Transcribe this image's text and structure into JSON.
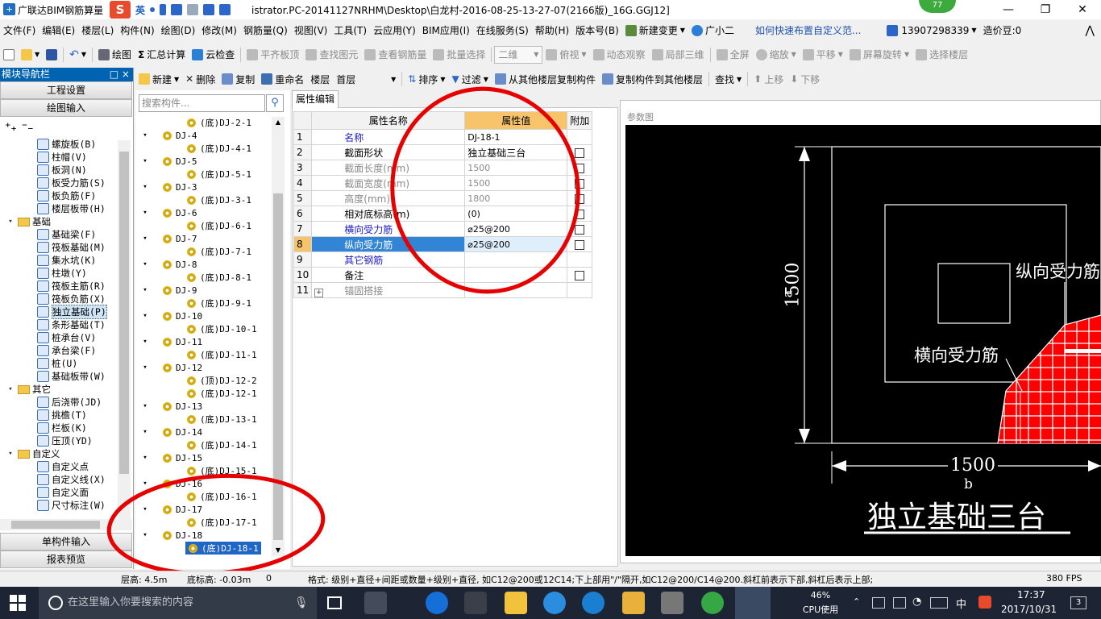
{
  "window": {
    "title": "广联达BIM钢筋算量",
    "title_path": "istrator.PC-20141127NRHM\\Desktop\\白龙村-2016-08-25-13-27-07(2166版)_16G.GGJ12]",
    "badge": "77",
    "ime": {
      "logo": "S",
      "lang": "英"
    }
  },
  "menu": [
    "文件(F)",
    "编辑(E)",
    "楼层(L)",
    "构件(N)",
    "绘图(D)",
    "修改(M)",
    "钢筋量(Q)",
    "视图(V)",
    "工具(T)",
    "云应用(Y)",
    "BIM应用(I)",
    "在线服务(S)",
    "帮助(H)",
    "版本号(B)",
    "新建变更",
    "广小二"
  ],
  "menu_extra": {
    "link": "如何快速布置自定义范...",
    "phone": "13907298339",
    "coins": "造价豆:0"
  },
  "toolbar": {
    "draw": "绘图",
    "sum": "汇总计算",
    "cloud_check": "云检查",
    "flat": "平齐板顶",
    "find_elem": "查找图元",
    "view_rebar": "查看钢筋量",
    "batch_select": "批量选择",
    "view_mode": "二维",
    "bird_view": "俯视",
    "dyn_view": "动态观察",
    "local_3d": "局部三维",
    "full_screen": "全屏",
    "zoom": "缩放",
    "pan": "平移",
    "rotate": "屏幕旋转",
    "select_layer": "选择楼层"
  },
  "subtoolbar": {
    "new": "新建",
    "delete": "删除",
    "copy": "复制",
    "rename": "重命名",
    "floor_label": "楼层",
    "floor_value": "首层",
    "sort": "排序",
    "filter": "过滤",
    "copy_from": "从其他楼层复制构件",
    "copy_to": "复制构件到其他楼层",
    "find": "查找",
    "up": "上移",
    "down": "下移"
  },
  "leftnav": {
    "header": "模块导航栏",
    "pin": "□ ×",
    "project_settings": "工程设置",
    "drawing_input": "绘图输入",
    "items": [
      {
        "label": "螺旋板(B)",
        "type": "item"
      },
      {
        "label": "柱帽(V)",
        "type": "item"
      },
      {
        "label": "板洞(N)",
        "type": "item"
      },
      {
        "label": "板受力筋(S)",
        "type": "item"
      },
      {
        "label": "板负筋(F)",
        "type": "item"
      },
      {
        "label": "楼层板带(H)",
        "type": "item"
      },
      {
        "label": "基础",
        "type": "folder"
      },
      {
        "label": "基础梁(F)",
        "type": "item"
      },
      {
        "label": "筏板基础(M)",
        "type": "item"
      },
      {
        "label": "集水坑(K)",
        "type": "item"
      },
      {
        "label": "柱墩(Y)",
        "type": "item"
      },
      {
        "label": "筏板主筋(R)",
        "type": "item"
      },
      {
        "label": "筏板负筋(X)",
        "type": "item"
      },
      {
        "label": "独立基础(P)",
        "type": "item",
        "selected": true
      },
      {
        "label": "条形基础(T)",
        "type": "item"
      },
      {
        "label": "桩承台(V)",
        "type": "item"
      },
      {
        "label": "承台梁(F)",
        "type": "item"
      },
      {
        "label": "桩(U)",
        "type": "item"
      },
      {
        "label": "基础板带(W)",
        "type": "item"
      },
      {
        "label": "其它",
        "type": "folder"
      },
      {
        "label": "后浇带(JD)",
        "type": "item"
      },
      {
        "label": "挑檐(T)",
        "type": "item"
      },
      {
        "label": "栏板(K)",
        "type": "item"
      },
      {
        "label": "压顶(YD)",
        "type": "item"
      },
      {
        "label": "自定义",
        "type": "folder"
      },
      {
        "label": "自定义点",
        "type": "item"
      },
      {
        "label": "自定义线(X)",
        "type": "item"
      },
      {
        "label": "自定义面",
        "type": "item"
      },
      {
        "label": "尺寸标注(W)",
        "type": "item"
      }
    ],
    "single_input": "单构件输入",
    "report": "报表预览"
  },
  "search": {
    "placeholder": "搜索构件..."
  },
  "components": [
    {
      "label": "(底)DJ-2-1",
      "level": 2
    },
    {
      "label": "DJ-4",
      "level": 1
    },
    {
      "label": "(底)DJ-4-1",
      "level": 2
    },
    {
      "label": "DJ-5",
      "level": 1
    },
    {
      "label": "(底)DJ-5-1",
      "level": 2
    },
    {
      "label": "DJ-3",
      "level": 1
    },
    {
      "label": "(底)DJ-3-1",
      "level": 2
    },
    {
      "label": "DJ-6",
      "level": 1
    },
    {
      "label": "(底)DJ-6-1",
      "level": 2
    },
    {
      "label": "DJ-7",
      "level": 1
    },
    {
      "label": "(底)DJ-7-1",
      "level": 2
    },
    {
      "label": "DJ-8",
      "level": 1
    },
    {
      "label": "(底)DJ-8-1",
      "level": 2
    },
    {
      "label": "DJ-9",
      "level": 1
    },
    {
      "label": "(底)DJ-9-1",
      "level": 2
    },
    {
      "label": "DJ-10",
      "level": 1
    },
    {
      "label": "(底)DJ-10-1",
      "level": 2
    },
    {
      "label": "DJ-11",
      "level": 1
    },
    {
      "label": "(底)DJ-11-1",
      "level": 2
    },
    {
      "label": "DJ-12",
      "level": 1
    },
    {
      "label": "(顶)DJ-12-2",
      "level": 2
    },
    {
      "label": "(底)DJ-12-1",
      "level": 2
    },
    {
      "label": "DJ-13",
      "level": 1
    },
    {
      "label": "(底)DJ-13-1",
      "level": 2
    },
    {
      "label": "DJ-14",
      "level": 1
    },
    {
      "label": "(底)DJ-14-1",
      "level": 2
    },
    {
      "label": "DJ-15",
      "level": 1
    },
    {
      "label": "(底)DJ-15-1",
      "level": 2
    },
    {
      "label": "DJ-16",
      "level": 1
    },
    {
      "label": "(底)DJ-16-1",
      "level": 2
    },
    {
      "label": "DJ-17",
      "level": 1
    },
    {
      "label": "(底)DJ-17-1",
      "level": 2
    },
    {
      "label": "DJ-18",
      "level": 1
    },
    {
      "label": "(底)DJ-18-1",
      "level": 2,
      "selected": true
    }
  ],
  "properties": {
    "tab": "属性编辑",
    "headers": {
      "name": "属性名称",
      "value": "属性值",
      "extra": "附加"
    },
    "rows": [
      {
        "num": "1",
        "name": "名称",
        "value": "DJ-18-1",
        "style": "blue",
        "check": false
      },
      {
        "num": "2",
        "name": "截面形状",
        "value": "独立基础三台",
        "style": "",
        "check": true
      },
      {
        "num": "3",
        "name": "截面长度(mm)",
        "value": "1500",
        "style": "gray",
        "check": true
      },
      {
        "num": "4",
        "name": "截面宽度(mm)",
        "value": "1500",
        "style": "gray",
        "check": true
      },
      {
        "num": "5",
        "name": "高度(mm)",
        "value": "1800",
        "style": "gray",
        "check": true
      },
      {
        "num": "6",
        "name": "相对底标高(m)",
        "value": "(0)",
        "style": "",
        "check": true
      },
      {
        "num": "7",
        "name": "横向受力筋",
        "value": "⌀25@200",
        "style": "blue",
        "check": true
      },
      {
        "num": "8",
        "name": "纵向受力筋",
        "value": "⌀25@200",
        "style": "blue",
        "check": true,
        "selected": true
      },
      {
        "num": "9",
        "name": "其它钢筋",
        "value": "",
        "style": "blue",
        "check": false
      },
      {
        "num": "10",
        "name": "备注",
        "value": "",
        "style": "",
        "check": true
      },
      {
        "num": "11",
        "name": "锚固搭接",
        "value": "",
        "style": "gray",
        "check": false,
        "expand": "+"
      }
    ]
  },
  "diagram": {
    "caption": "参数图",
    "dim_a": "1500",
    "label_a": "a",
    "dim_b": "1500",
    "label_b": "b",
    "label_long": "纵向受力筋",
    "label_trans": "横向受力筋",
    "title": "独立基础三台"
  },
  "status": {
    "floor_height": "层高: 4.5m",
    "bottom_elev": "底标高: -0.03m",
    "zero": "0",
    "hint": "格式: 级别+直径+间距或数量+级别+直径, 如C12@200或12C14;下上部用\"/\"隔开,如C12@200/C14@200.斜杠前表示下部,斜杠后表示上部;",
    "fps": "380 FPS"
  },
  "taskbar": {
    "search_placeholder": "在这里输入你要搜索的内容",
    "cpu": "46%",
    "cpu_label": "CPU使用",
    "ime": "中",
    "time": "17:37",
    "date": "2017/10/31",
    "notif": "3"
  },
  "colors": {
    "accent": "#0063b1",
    "selected_row": "#3284d6",
    "header_value": "#f7c46b",
    "annotation": "#e60000",
    "rebar_grid": "#e60000"
  }
}
